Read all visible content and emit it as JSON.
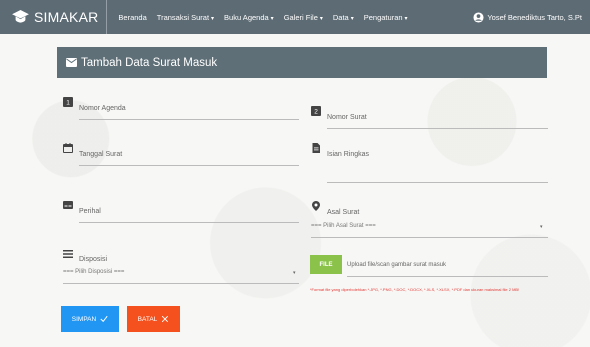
{
  "navbar": {
    "brand": "SIMAKAR",
    "menu": [
      {
        "label": "Beranda",
        "caret": ""
      },
      {
        "label": "Transaksi Surat",
        "caret": "▾"
      },
      {
        "label": "Buku Agenda",
        "caret": "▾"
      },
      {
        "label": "Galeri File",
        "caret": "▾"
      },
      {
        "label": "Data",
        "caret": "▾"
      },
      {
        "label": "Pengaturan",
        "caret": "▾"
      }
    ],
    "user": "Yosef Benediktus Tarto, S.Pt",
    "user_caret": "▾"
  },
  "form": {
    "title": "Tambah Data Surat Masuk",
    "nomor_agenda": "Nomor Agenda",
    "nomor_surat": "Nomor Surat",
    "tanggal_surat": "Tanggal Surat",
    "isian_ringkas": "Isian Ringkas",
    "perihal": "Perihal",
    "asal_surat": "Asal Surat",
    "asal_surat_select": "=== Pilih Asal Surat ===",
    "disposisi": "Disposisi",
    "disposisi_select": "=== Pilih Disposisi ===",
    "select_caret": "▾",
    "file_button": "FILE",
    "file_placeholder": "Upload file/scan gambar surat masuk",
    "file_hint": "*Format file yang diperbolehkan *.JPG, *.PNG, *.DOC, *.DOCX, *.XLS, *.XLSX, *.PDF dan ukuran maksimal file 2 MB!",
    "save_label": "SIMPAN",
    "cancel_label": "BATAL"
  },
  "colors": {
    "navbar": "#5d6b74",
    "card_header": "#5e6f77",
    "save": "#2196f3",
    "cancel": "#f4511e",
    "file": "#8bc34a",
    "hint": "#e53935"
  },
  "icons": {
    "brand": "graduation-cap-icon",
    "user": "account-circle-icon",
    "header": "mail-icon",
    "nomor_agenda": "looks-one-icon",
    "nomor_surat": "looks-two-icon",
    "tanggal_surat": "calendar-icon",
    "isian_ringkas": "description-icon",
    "perihal": "subtitles-icon",
    "asal_surat": "place-icon",
    "disposisi": "list-icon",
    "save": "check-icon",
    "cancel": "close-icon"
  }
}
